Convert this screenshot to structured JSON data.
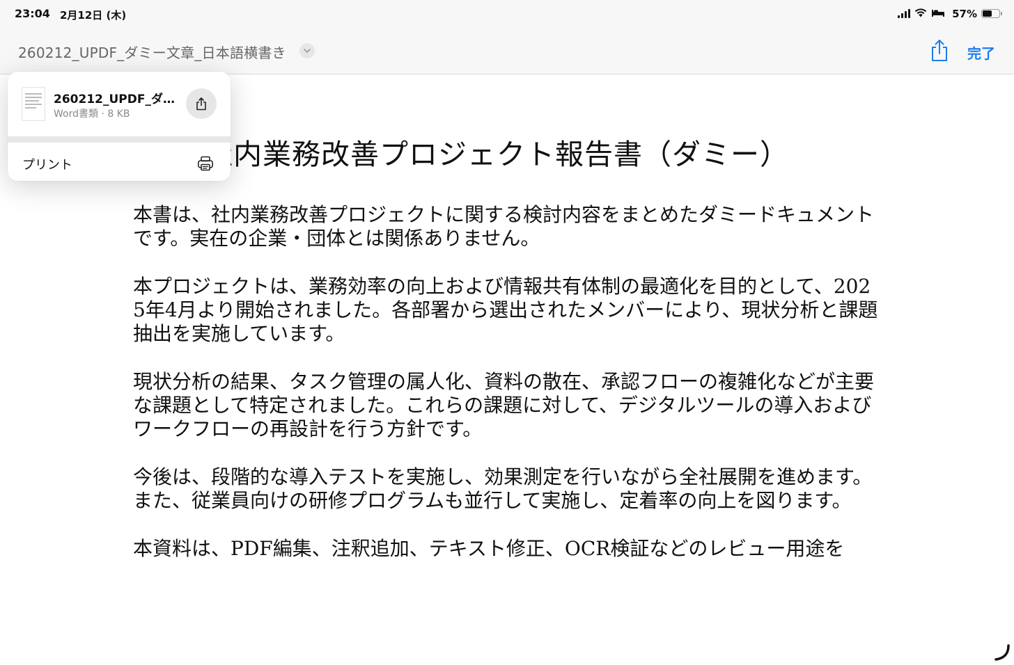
{
  "status_bar": {
    "time": "23:04",
    "date": "2月12日 (木)",
    "battery": "57%",
    "battery_level": 0.57
  },
  "toolbar": {
    "document_title": "260212_UPDF_ダミー文章_日本語横書き",
    "done_label": "完了",
    "accent_color": "#1a7ef2"
  },
  "popover": {
    "file_name": "260212_UPDF_ダ…",
    "file_meta": "Word書類 · 8 KB",
    "print_label": "プリント"
  },
  "document": {
    "heading": "社内業務改善プロジェクト報告書（ダミー）",
    "paragraphs": [
      "本書は、社内業務改善プロジェクトに関する検討内容をまとめたダミードキュメントです。実在の企業・団体とは関係ありません。",
      "本プロジェクトは、業務効率の向上および情報共有体制の最適化を目的として、2025年4月より開始されました。各部署から選出されたメンバーにより、現状分析と課題抽出を実施しています。",
      "現状分析の結果、タスク管理の属人化、資料の散在、承認フローの複雑化などが主要な課題として特定されました。これらの課題に対して、デジタルツールの導入およびワークフローの再設計を行う方針です。",
      "今後は、段階的な導入テストを実施し、効果測定を行いながら全社展開を進めます。また、従業員向けの研修プログラムも並行して実施し、定着率の向上を図ります。",
      "本資料は、PDF編集、注釈追加、テキスト修正、OCR検証などのレビュー用途を"
    ]
  }
}
